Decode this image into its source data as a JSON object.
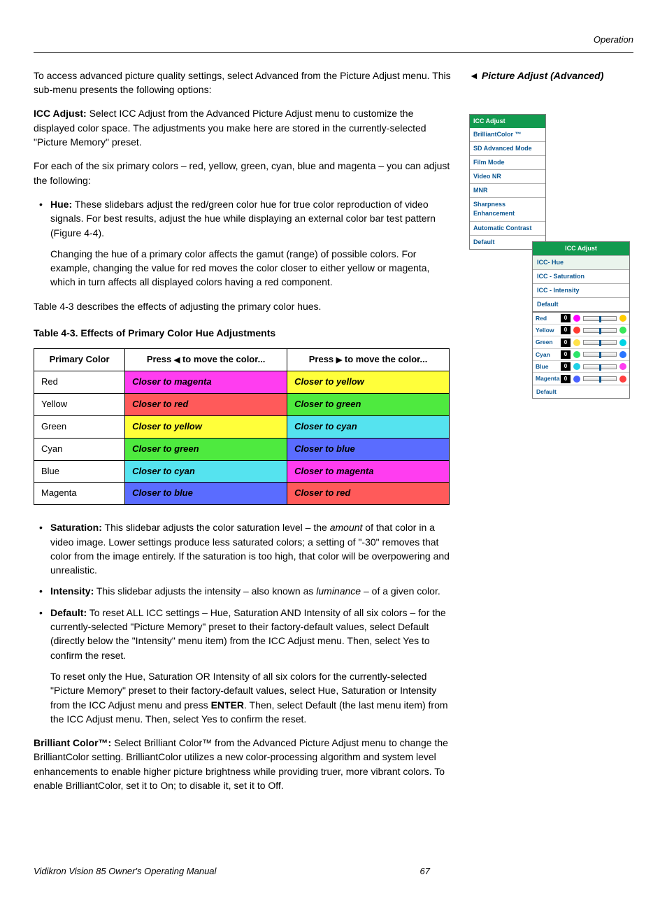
{
  "header": {
    "section": "Operation"
  },
  "sidebar_heading": "Picture Adjust (Advanced)",
  "menu": {
    "title": "ICC Adjust",
    "items": [
      "BrilliantColor ™",
      "SD Advanced Mode",
      "Film Mode",
      "Video NR",
      "MNR",
      "Sharpness Enhancement",
      "Automatic Contrast",
      "Default"
    ]
  },
  "submenu": {
    "title": "ICC Adjust",
    "items": [
      "ICC- Hue",
      "ICC - Saturation",
      "ICC - Intensity",
      "Default"
    ]
  },
  "sliders": {
    "rows": [
      {
        "label": "Red",
        "val": "0",
        "left": "#ff00ff",
        "right": "#ffcc00"
      },
      {
        "label": "Yellow",
        "val": "0",
        "left": "#ff3b30",
        "right": "#39e85a"
      },
      {
        "label": "Green",
        "val": "0",
        "left": "#ffe24a",
        "right": "#00d4e5"
      },
      {
        "label": "Cyan",
        "val": "0",
        "left": "#2de56a",
        "right": "#2a75ff"
      },
      {
        "label": "Blue",
        "val": "0",
        "left": "#1ed0e5",
        "right": "#ff3df0"
      },
      {
        "label": "Magenta",
        "val": "0",
        "left": "#4a62ff",
        "right": "#ff4040"
      }
    ],
    "default": "Default"
  },
  "intro": {
    "p1": "To access advanced picture quality settings, select Advanced from the Picture Adjust menu. This sub-menu presents the following options:",
    "icc_b": "ICC Adjust:",
    "icc": " Select ICC Adjust from the Advanced Picture Adjust menu to customize the displayed color space. The adjustments you make here are stored in the currently-selected \"Picture Memory\" preset.",
    "p3": "For each of the six primary colors – red, yellow, green, cyan, blue and magenta – you can adjust the following:"
  },
  "bullets1": {
    "hue_b": "Hue:",
    "hue": " These slidebars adjust the red/green color hue for true color reproduction of video signals. For best results, adjust the hue while displaying an external color bar test pattern (Figure 4-4).",
    "hue2": "Changing the hue of a primary color affects the gamut (range) of possible colors. For example, changing the value for red moves the color closer to either yellow or magenta, which in turn affects all displayed colors having a red component."
  },
  "table_lead": "Table 4-3 describes the effects of adjusting the primary color hues.",
  "table_title": "Table 4-3. Effects of Primary Color Hue Adjustments",
  "table": {
    "h1": "Primary Color",
    "h2a": "Press ",
    "h2b": " to move the color...",
    "h3a": "Press ",
    "h3b": " to move the color...",
    "rows": [
      {
        "c": "Red",
        "l": "Closer to magenta",
        "lbg": "#ff3df0",
        "r": "Closer to yellow",
        "rbg": "#ffff3a"
      },
      {
        "c": "Yellow",
        "l": "Closer to red",
        "lbg": "#ff5a5a",
        "r": "Closer to green",
        "rbg": "#4eea3f"
      },
      {
        "c": "Green",
        "l": "Closer to yellow",
        "lbg": "#ffff3a",
        "r": "Closer to cyan",
        "rbg": "#55e3ef"
      },
      {
        "c": "Cyan",
        "l": "Closer to green",
        "lbg": "#4eea3f",
        "r": "Closer to blue",
        "rbg": "#5a6cff"
      },
      {
        "c": "Blue",
        "l": "Closer to cyan",
        "lbg": "#55e3ef",
        "r": "Closer to magenta",
        "rbg": "#ff3df0"
      },
      {
        "c": "Magenta",
        "l": "Closer to blue",
        "lbg": "#5a6cff",
        "r": "Closer to red",
        "rbg": "#ff5a5a"
      }
    ]
  },
  "bullets2": {
    "sat_b": "Saturation:",
    "sat": " This slidebar adjusts the color saturation level – the ",
    "sat_i": "amount",
    "sat2": " of that color in a video image. Lower settings produce less saturated colors; a setting of \"-30\" removes that color from the image entirely. If the saturation is too high, that color will be overpowering and unrealistic.",
    "int_b": "Intensity:",
    "int": " This slidebar adjusts the intensity – also known as ",
    "int_i": "luminance",
    "int2": " – of a given color.",
    "def_b": "Default:",
    "def": " To reset ALL ICC settings – Hue, Saturation AND Intensity of all six colors – for the currently-selected \"Picture Memory\" preset to their factory-default values, select Default (directly below the \"Intensity\" menu item) from the ICC Adjust menu. Then, select Yes to confirm the reset.",
    "def2a": "To reset only the Hue, Saturation OR Intensity of all six colors for the currently-selected \"Picture Memory\" preset to their factory-default values, select Hue, Saturation or Intensity from the ICC Adjust menu and press ",
    "def2_enter": "ENTER",
    "def2b": ". Then, select Default (the last menu item) from the ICC Adjust menu. Then, select Yes to confirm the reset."
  },
  "brilliant": {
    "b": "Brilliant Color™:",
    "t": " Select Brilliant Color™ from the Advanced Picture Adjust menu to change the BrilliantColor setting. BrilliantColor utilizes a new color-processing algorithm and system level enhancements to enable higher picture brightness while providing truer, more vibrant colors. To enable BrilliantColor, set it to On; to disable it, set it to Off."
  },
  "footer": {
    "left": "Vidikron Vision 85 Owner's Operating Manual",
    "page": "67"
  }
}
